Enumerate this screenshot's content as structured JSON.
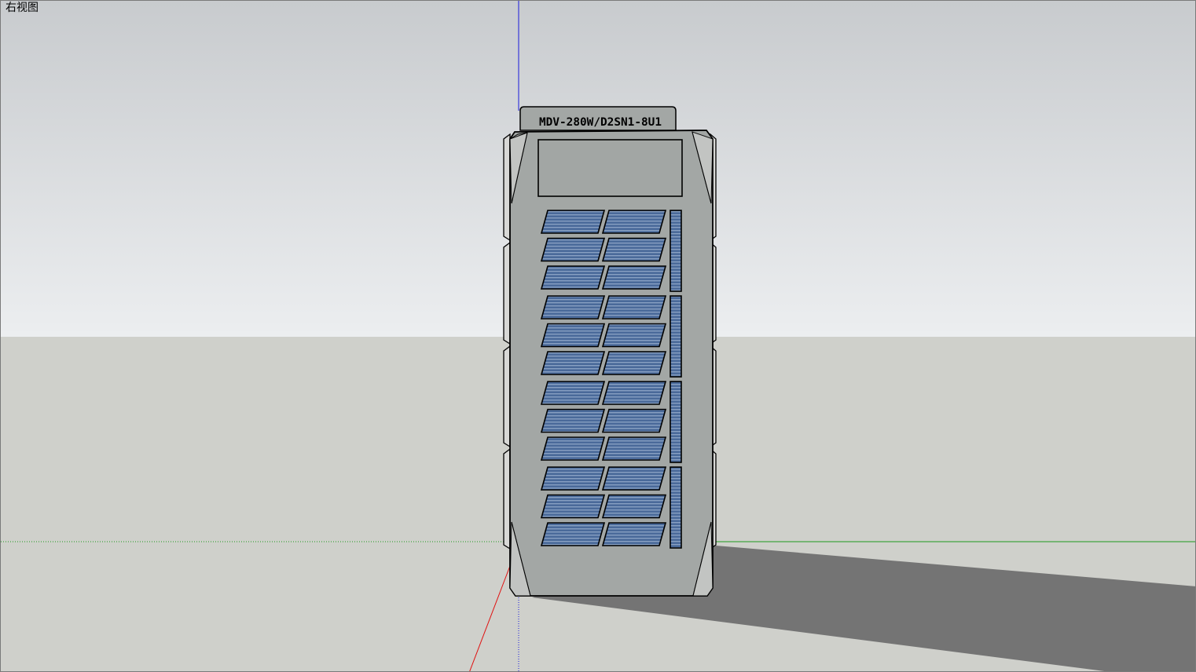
{
  "viewport": {
    "view_label": "右视图",
    "colors": {
      "sky_top": "#c8cbce",
      "sky_bottom": "#eceef0",
      "ground": "#cfd0cb",
      "shadow": "#747474",
      "axis_blue": "#1a1adc",
      "axis_red": "#e01010",
      "axis_green": "#1c9a1c"
    }
  },
  "model": {
    "name": "outdoor-unit",
    "nameplate_text": "MDV-280W/D2SN1-8U1",
    "colors": {
      "body": "#a3a7a5",
      "side_frame": "#d8d8d6",
      "panel_screen": "#a2a6a4",
      "coil": "#4a6a9a",
      "coil_stripe": "#8aa2c4",
      "outline": "#000000"
    },
    "coil_rows": 12,
    "coil_columns": 2,
    "coil_groups": 4
  }
}
